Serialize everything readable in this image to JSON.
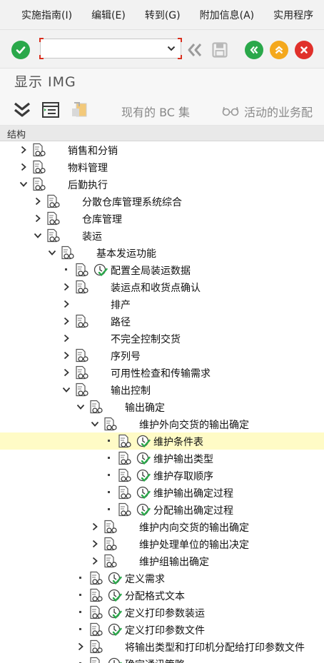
{
  "menubar": {
    "items": [
      "实施指南(I)",
      "编辑(E)",
      "转到(G)",
      "附加信息(A)",
      "实用程序"
    ]
  },
  "toolbar": {
    "command_value": "",
    "buttons": [
      "enter-check",
      "back-nav",
      "save",
      "back",
      "exit",
      "cancel"
    ]
  },
  "title": "显示 IMG",
  "toolbar2": {
    "existing_bc_sets": "现有的 BC 集",
    "active_business_config": "活动的业务配"
  },
  "structure_header": "结构",
  "colors": {
    "accent_green": "#2aa84a",
    "accent_orange": "#f4a81d",
    "accent_red": "#e0302a",
    "highlight_row": "#fffbc6"
  },
  "tree": [
    {
      "label": "销售和分销",
      "level": 0,
      "toggle": "collapsed",
      "doc": true,
      "activity": false
    },
    {
      "label": "物料管理",
      "level": 0,
      "toggle": "collapsed",
      "doc": true,
      "activity": false
    },
    {
      "label": "后勤执行",
      "level": 0,
      "toggle": "expanded",
      "doc": true,
      "activity": false
    },
    {
      "label": "分散仓库管理系统综合",
      "level": 1,
      "toggle": "collapsed",
      "doc": true,
      "activity": false
    },
    {
      "label": "仓库管理",
      "level": 1,
      "toggle": "collapsed",
      "doc": true,
      "activity": false
    },
    {
      "label": "装运",
      "level": 1,
      "toggle": "expanded",
      "doc": true,
      "activity": false
    },
    {
      "label": "基本发运功能",
      "level": 2,
      "toggle": "expanded",
      "doc": true,
      "activity": false
    },
    {
      "label": "配置全局装运数据",
      "level": 3,
      "toggle": "leaf",
      "doc": true,
      "activity": true
    },
    {
      "label": "装运点和收货点确认",
      "level": 3,
      "toggle": "collapsed",
      "doc": true,
      "activity": false
    },
    {
      "label": "排产",
      "level": 3,
      "toggle": "collapsed",
      "doc": false,
      "activity": false
    },
    {
      "label": "路径",
      "level": 3,
      "toggle": "collapsed",
      "doc": true,
      "activity": false
    },
    {
      "label": "不完全控制交货",
      "level": 3,
      "toggle": "collapsed",
      "doc": false,
      "activity": false
    },
    {
      "label": "序列号",
      "level": 3,
      "toggle": "collapsed",
      "doc": true,
      "activity": false
    },
    {
      "label": "可用性检查和传输需求",
      "level": 3,
      "toggle": "collapsed",
      "doc": true,
      "activity": false
    },
    {
      "label": "输出控制",
      "level": 3,
      "toggle": "expanded",
      "doc": true,
      "activity": false
    },
    {
      "label": "输出确定",
      "level": 4,
      "toggle": "expanded",
      "doc": true,
      "activity": false
    },
    {
      "label": "维护外向交货的输出确定",
      "level": 5,
      "toggle": "expanded",
      "doc": true,
      "activity": false
    },
    {
      "label": "维护条件表",
      "level": 6,
      "toggle": "leaf",
      "doc": true,
      "activity": true,
      "highlighted": true
    },
    {
      "label": "维护输出类型",
      "level": 6,
      "toggle": "leaf",
      "doc": true,
      "activity": true
    },
    {
      "label": "维护存取顺序",
      "level": 6,
      "toggle": "leaf",
      "doc": true,
      "activity": true
    },
    {
      "label": "维护输出确定过程",
      "level": 6,
      "toggle": "leaf",
      "doc": true,
      "activity": true
    },
    {
      "label": "分配输出确定过程",
      "level": 6,
      "toggle": "leaf",
      "doc": true,
      "activity": true
    },
    {
      "label": "维护内向交货的输出确定",
      "level": 5,
      "toggle": "collapsed",
      "doc": true,
      "activity": false
    },
    {
      "label": "维护处理单位的输出决定",
      "level": 5,
      "toggle": "collapsed",
      "doc": true,
      "activity": false
    },
    {
      "label": "维护组输出确定",
      "level": 5,
      "toggle": "collapsed",
      "doc": true,
      "activity": false
    },
    {
      "label": "定义需求",
      "level": 4,
      "toggle": "leaf",
      "doc": true,
      "activity": true
    },
    {
      "label": "分配格式文本",
      "level": 4,
      "toggle": "leaf",
      "doc": true,
      "activity": true
    },
    {
      "label": "定义打印参数装运",
      "level": 4,
      "toggle": "leaf",
      "doc": true,
      "activity": true
    },
    {
      "label": "定义打印参数文件",
      "level": 4,
      "toggle": "leaf",
      "doc": true,
      "activity": true
    },
    {
      "label": "将输出类型和打印机分配给打印参数文件",
      "level": 4,
      "toggle": "collapsed",
      "doc": true,
      "activity": false
    },
    {
      "label": "确定通讯策略",
      "level": 4,
      "toggle": "leaf",
      "doc": true,
      "activity": true
    }
  ]
}
